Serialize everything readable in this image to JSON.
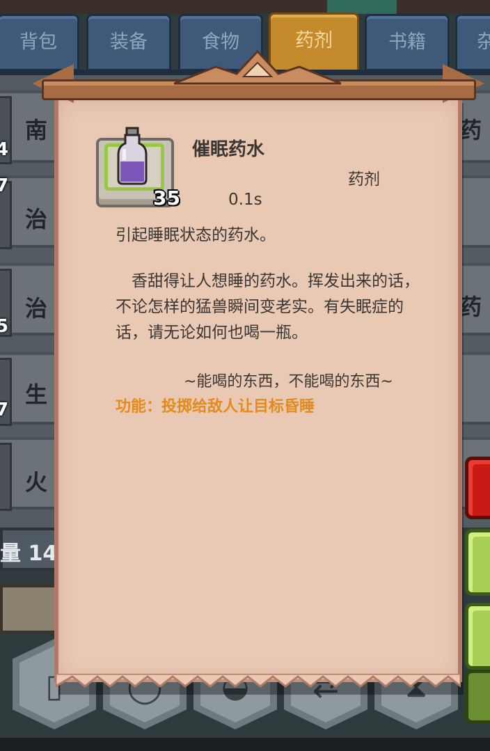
{
  "tabs": [
    {
      "label": "背包",
      "active": false
    },
    {
      "label": "装备",
      "active": false
    },
    {
      "label": "食物",
      "active": false
    },
    {
      "label": "药剂",
      "active": true
    },
    {
      "label": "书籍",
      "active": false
    },
    {
      "label": "杂",
      "active": false
    }
  ],
  "list": {
    "rows": [
      {
        "name": "南",
        "name_right": "药",
        "count": "4"
      },
      {
        "name": "治",
        "name_right": "",
        "count": "7"
      },
      {
        "name": "治",
        "name_right": "药",
        "count": "5"
      },
      {
        "name": "生",
        "name_right": "",
        "count": "7"
      },
      {
        "name": "火",
        "name_right": "",
        "count": ""
      }
    ],
    "capacity_label": "量 14"
  },
  "tooltip": {
    "name": "催眠药水",
    "category": "药剂",
    "duration": "0.1s",
    "stack_count": "35",
    "summary": "引起睡眠状态的药水。",
    "description": "　香甜得让人想睡的药水。挥发出来的话，不论怎样的猛兽瞬间变老实。有失眠症的话，请无论如何也喝一瓶。",
    "quote": "~能喝的东西，不能喝的东西~",
    "function": "功能：投掷给敌人让目标昏睡"
  },
  "bottom_buttons": [
    {
      "icon": "book-icon"
    },
    {
      "icon": "magnifier-icon"
    },
    {
      "icon": "bowl-icon"
    },
    {
      "icon": "swap-icon"
    },
    {
      "icon": "hourglass-icon"
    }
  ],
  "colors": {
    "active_tab": "#c48a2c",
    "tab": "#3f5a78",
    "parchment": "#e9c8b4",
    "function_text": "#e38b1c",
    "slot_highlight": "#96c843"
  }
}
